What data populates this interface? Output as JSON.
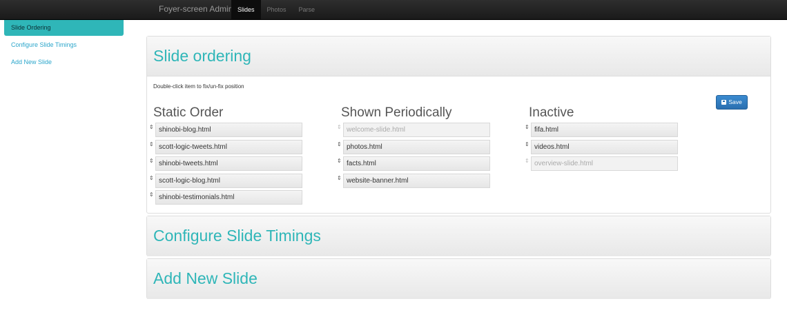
{
  "navbar": {
    "brand": "Foyer-screen Admin",
    "items": [
      {
        "label": "Slides",
        "active": true
      },
      {
        "label": "Photos",
        "active": false
      },
      {
        "label": "Parse",
        "active": false
      }
    ]
  },
  "sidebar": {
    "items": [
      {
        "label": "Slide Ordering",
        "active": true
      },
      {
        "label": "Configure Slide Timings",
        "active": false
      },
      {
        "label": "Add New Slide",
        "active": false
      }
    ]
  },
  "ordering": {
    "title": "Slide ordering",
    "hint": "Double-click item to fix/un-fix position",
    "save_label": "Save",
    "columns": [
      {
        "title": "Static Order",
        "items": [
          {
            "label": "shinobi-blog.html",
            "fixed": false
          },
          {
            "label": "scott-logic-tweets.html",
            "fixed": false
          },
          {
            "label": "shinobi-tweets.html",
            "fixed": false
          },
          {
            "label": "scott-logic-blog.html",
            "fixed": false
          },
          {
            "label": "shinobi-testimonials.html",
            "fixed": false
          }
        ]
      },
      {
        "title": "Shown Periodically",
        "items": [
          {
            "label": "welcome-slide.html",
            "fixed": true
          },
          {
            "label": "photos.html",
            "fixed": false
          },
          {
            "label": "facts.html",
            "fixed": false
          },
          {
            "label": "website-banner.html",
            "fixed": false
          }
        ]
      },
      {
        "title": "Inactive",
        "items": [
          {
            "label": "fifa.html",
            "fixed": false
          },
          {
            "label": "videos.html",
            "fixed": false
          },
          {
            "label": "overview-slide.html",
            "fixed": true
          }
        ]
      }
    ]
  },
  "timings": {
    "title": "Configure Slide Timings"
  },
  "new_slide": {
    "title": "Add New Slide"
  },
  "icons": {
    "handle": "drag-handle-icon",
    "save": "floppy-disk-icon"
  },
  "colors": {
    "accent": "#2fb6b8",
    "link": "#2ba6cb",
    "save_button": "#2a6fb0"
  }
}
